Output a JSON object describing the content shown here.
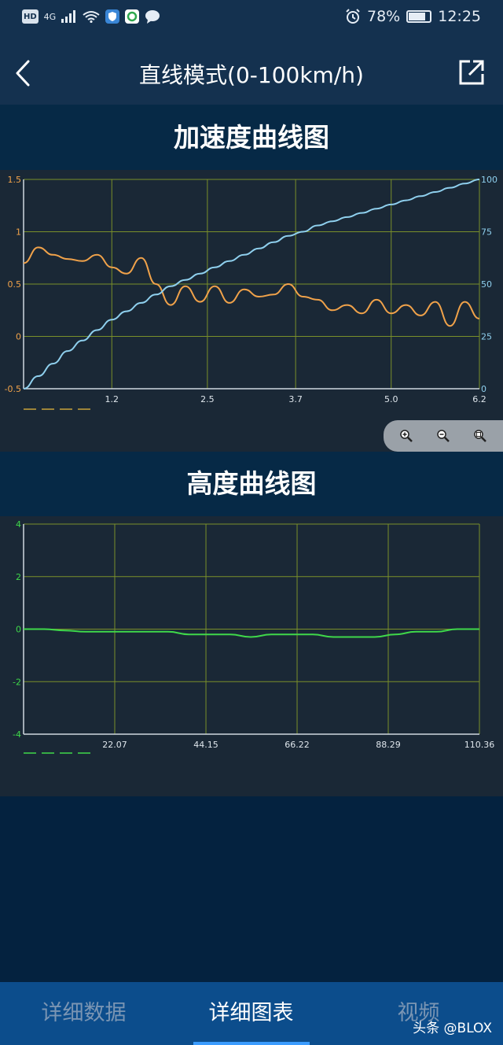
{
  "status_bar": {
    "hd_badge": "HD",
    "network": "4G",
    "battery_percent": "78%",
    "battery_level": 0.78,
    "time": "12:25"
  },
  "header": {
    "title": "直线模式(0-100km/h)"
  },
  "accel_chart": {
    "title": "加速度曲线图"
  },
  "altitude_chart": {
    "title": "高度曲线图"
  },
  "tabs": [
    {
      "label": "详细数据",
      "active": false
    },
    {
      "label": "详细图表",
      "active": true
    },
    {
      "label": "视频",
      "active": false
    }
  ],
  "watermark": "头条 @BLOX",
  "colors": {
    "accel_series": "#f0a24a",
    "speed_series": "#8fd0ee",
    "altitude_series": "#3fd84a",
    "grid": "#7a8f2a",
    "tab_active": "#ffffff",
    "tab_inactive": "#7a95b3"
  },
  "chart_data": [
    {
      "type": "line",
      "title": "加速度曲线图",
      "x": [
        0.0,
        0.2,
        0.4,
        0.6,
        0.8,
        1.0,
        1.2,
        1.4,
        1.6,
        1.8,
        2.0,
        2.2,
        2.4,
        2.6,
        2.8,
        3.0,
        3.2,
        3.4,
        3.6,
        3.8,
        4.0,
        4.2,
        4.4,
        4.6,
        4.8,
        5.0,
        5.2,
        5.4,
        5.6,
        5.8,
        6.0,
        6.2
      ],
      "xlim": [
        0,
        6.2
      ],
      "x_ticks": [
        "1.2",
        "2.5",
        "3.7",
        "5.0",
        "6.2"
      ],
      "y_left_ticks": [
        "1.5",
        "1",
        "0.5",
        "0",
        "-0.5"
      ],
      "y_left_lim": [
        -0.5,
        1.5
      ],
      "y_right_ticks": [
        "100",
        "75",
        "50",
        "25",
        "0"
      ],
      "y_right_lim": [
        0,
        100
      ],
      "grid": true,
      "series": [
        {
          "axis": "left",
          "color": "#f0a24a",
          "values": [
            0.7,
            0.85,
            0.78,
            0.74,
            0.72,
            0.78,
            0.66,
            0.6,
            0.75,
            0.5,
            0.3,
            0.48,
            0.33,
            0.48,
            0.32,
            0.45,
            0.38,
            0.4,
            0.5,
            0.38,
            0.35,
            0.25,
            0.3,
            0.22,
            0.35,
            0.22,
            0.3,
            0.2,
            0.33,
            0.1,
            0.33,
            0.17
          ]
        },
        {
          "axis": "right",
          "color": "#8fd0ee",
          "values": [
            0,
            6,
            12,
            18,
            23,
            28,
            33,
            37,
            41,
            45,
            49,
            52,
            55,
            58,
            61,
            64,
            67,
            70,
            73,
            75,
            78,
            80,
            82,
            84,
            86,
            88,
            90,
            92,
            94,
            96,
            98,
            100
          ]
        }
      ]
    },
    {
      "type": "line",
      "title": "高度曲线图",
      "x": [
        0,
        5,
        10,
        15,
        20,
        25,
        30,
        35,
        40,
        45,
        50,
        55,
        60,
        65,
        70,
        75,
        80,
        85,
        90,
        95,
        100,
        105,
        110.36
      ],
      "xlim": [
        0,
        110.36
      ],
      "x_ticks": [
        "22.07",
        "44.15",
        "66.22",
        "88.29",
        "110.36"
      ],
      "y_ticks": [
        "4",
        "2",
        "0",
        "-2",
        "-4"
      ],
      "ylim": [
        -4,
        4
      ],
      "grid": true,
      "series": [
        {
          "color": "#3fd84a",
          "values": [
            0,
            0,
            -0.05,
            -0.1,
            -0.1,
            -0.1,
            -0.1,
            -0.1,
            -0.2,
            -0.2,
            -0.2,
            -0.3,
            -0.2,
            -0.2,
            -0.2,
            -0.3,
            -0.3,
            -0.3,
            -0.2,
            -0.1,
            -0.1,
            0,
            0
          ]
        }
      ]
    }
  ]
}
